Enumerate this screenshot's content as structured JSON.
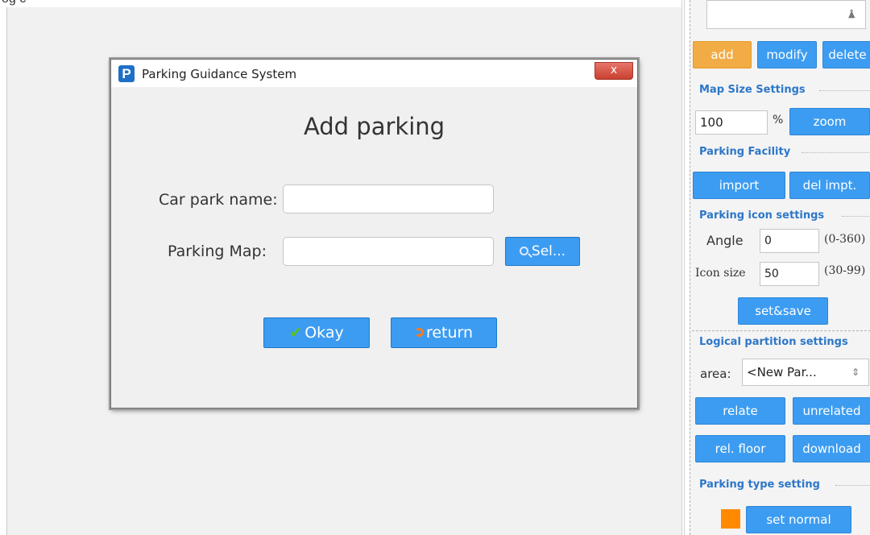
{
  "window": {
    "top_partial_text": "og c"
  },
  "dialog": {
    "title": "Parking Guidance System",
    "app_icon": "parking-app-icon",
    "close_label": "x",
    "heading": "Add parking",
    "car_park_name_label": "Car park name:",
    "car_park_name_value": "",
    "parking_map_label": "Parking Map:",
    "parking_map_value": "",
    "select_label": "Sel...",
    "okay_label": "Okay",
    "return_label": "return"
  },
  "panel": {
    "top_select_value": "",
    "add_label": "add",
    "modify_label": "modify",
    "delete_label": "delete",
    "map_size_title": "Map Size Settings",
    "map_size_value": "100",
    "percent_label": "%",
    "zoom_label": "zoom",
    "facility_title": "Parking Facility",
    "import_label": "import",
    "del_import_label": "del impt.",
    "icon_settings_title": "Parking icon settings",
    "angle_label": "Angle",
    "angle_value": "0",
    "angle_range": "(0-360)",
    "icon_size_label": "Icon size",
    "icon_size_value": "50",
    "icon_size_range": "(30-99)",
    "set_save_label": "set&save",
    "partition_title": "Logical partition settings",
    "area_label": "area:",
    "area_value": "<New Par...",
    "relate_label": "relate",
    "unrelated_label": "unrelated",
    "rel_floor_label": "rel. floor",
    "download_label": "download",
    "type_title": "Parking type setting",
    "set_normal_label": "set normal",
    "accent_color": "#3c9cf1",
    "orange_color": "#f2ac45",
    "swatch_color": "#ff8a00"
  }
}
